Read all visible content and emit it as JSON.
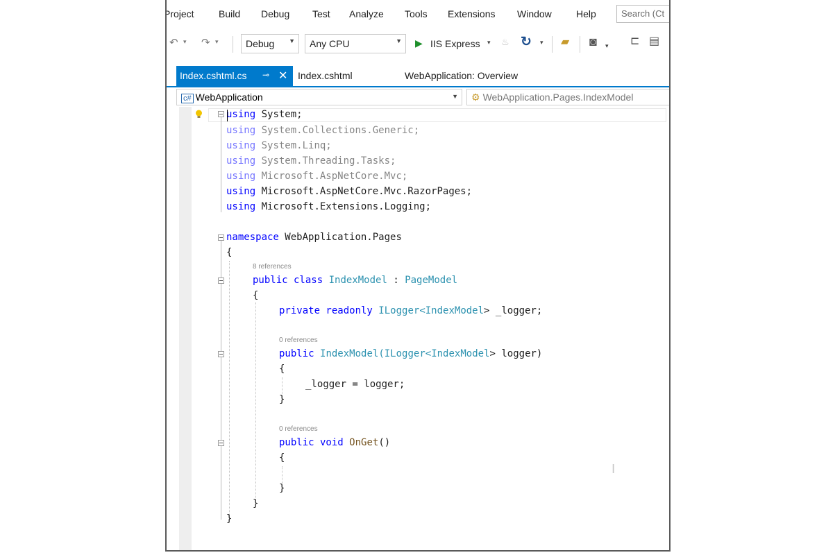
{
  "menu": [
    "Project",
    "Build",
    "Debug",
    "Test",
    "Analyze",
    "Tools",
    "Extensions",
    "Window",
    "Help"
  ],
  "search_placeholder": "Search (Ct",
  "toolbar": {
    "configuration": "Debug",
    "platform": "Any CPU",
    "run_target": "IIS Express"
  },
  "tabs": [
    {
      "label": "Index.cshtml.cs",
      "active": true
    },
    {
      "label": "Index.cshtml",
      "active": false
    },
    {
      "label": "WebApplication: Overview",
      "active": false
    }
  ],
  "navbar": {
    "project": "WebApplication",
    "type": "WebApplication.Pages.IndexModel"
  },
  "code": {
    "usings": [
      {
        "kw": "using",
        "ns": "System;",
        "used": true
      },
      {
        "kw": "using",
        "ns": "System.Collections.Generic;",
        "used": false
      },
      {
        "kw": "using",
        "ns": "System.Linq;",
        "used": false
      },
      {
        "kw": "using",
        "ns": "System.Threading.Tasks;",
        "used": false
      },
      {
        "kw": "using",
        "ns": "Microsoft.AspNetCore.Mvc;",
        "used": false
      },
      {
        "kw": "using",
        "ns": "Microsoft.AspNetCore.Mvc.RazorPages;",
        "used": true
      },
      {
        "kw": "using",
        "ns": "Microsoft.Extensions.Logging;",
        "used": true
      }
    ],
    "namespace_kw": "namespace",
    "namespace_name": "WebApplication.Pages",
    "open_brace": "{",
    "close_brace": "}",
    "class_refs": "8 references",
    "class_mods": "public class",
    "class_name": "IndexModel",
    "class_colon": " : ",
    "class_base": "PageModel",
    "field_mods": "private readonly",
    "field_type": "ILogger",
    "field_lt": "<",
    "field_generic": "IndexModel",
    "field_rest": "> _logger;",
    "ctor_refs": "0 references",
    "ctor_mod": "public",
    "ctor_name": "IndexModel",
    "ctor_paren": "(",
    "ctor_param_type": "ILogger",
    "ctor_param_lt": "<",
    "ctor_param_generic": "IndexModel",
    "ctor_param_rest": "> logger)",
    "ctor_body": "_logger = logger;",
    "onget_refs": "0 references",
    "onget_mods": "public void",
    "onget_name": "OnGet",
    "onget_parens": "()"
  }
}
